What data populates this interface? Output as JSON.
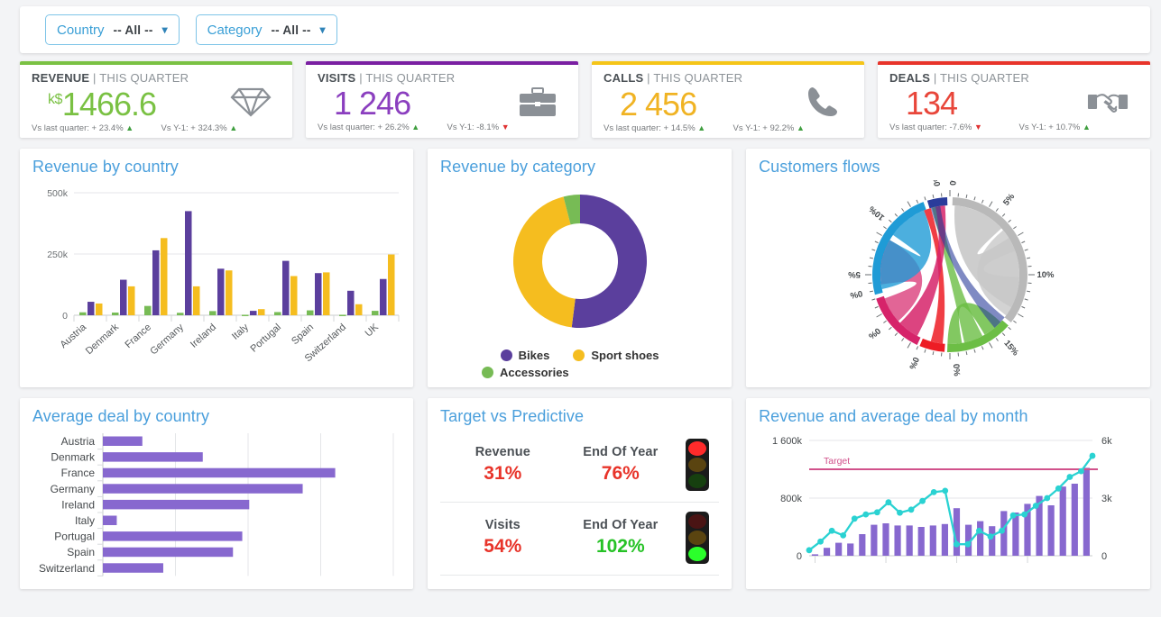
{
  "filters": [
    {
      "label": "Country",
      "value": "-- All --",
      "icon": "chevron-down-icon"
    },
    {
      "label": "Category",
      "value": "-- All --",
      "icon": "chevron-down-icon"
    }
  ],
  "kpis": [
    {
      "name": "REVENUE",
      "period": "THIS QUARTER",
      "prefix": "k$",
      "value": "1466.6",
      "color": "#7ac143",
      "bar": "#7ac143",
      "icon": "diamond-icon",
      "compare_quarter": "Vs last quarter: + 23.4%",
      "quarter_dir": "up",
      "compare_year": "Vs Y-1: + 324.3%",
      "year_dir": "up"
    },
    {
      "name": "VISITS",
      "period": "THIS QUARTER",
      "prefix": "",
      "value": "1 246",
      "color": "#8b3fbf",
      "bar": "#7a1fa2",
      "icon": "briefcase-icon",
      "compare_quarter": "Vs last quarter: + 26.2%",
      "quarter_dir": "up",
      "compare_year": "Vs Y-1: -8.1%",
      "year_dir": "down"
    },
    {
      "name": "CALLS",
      "period": "THIS QUARTER",
      "prefix": "",
      "value": "2 456",
      "color": "#f0b323",
      "bar": "#f5c518",
      "icon": "phone-icon",
      "compare_quarter": "Vs last quarter: + 14.5%",
      "quarter_dir": "up",
      "compare_year": "Vs Y-1: + 92.2%",
      "year_dir": "up"
    },
    {
      "name": "DEALS",
      "period": "THIS QUARTER",
      "prefix": "",
      "value": "134",
      "color": "#e8463a",
      "bar": "#e8342a",
      "icon": "handshake-icon",
      "compare_quarter": "Vs last quarter: -7.6%",
      "quarter_dir": "down",
      "compare_year": "Vs Y-1: + 10.7%",
      "year_dir": "up"
    }
  ],
  "panels": {
    "revenue_by_country": "Revenue by country",
    "revenue_by_category": "Revenue by category",
    "customers_flows": "Customers flows",
    "average_deal": "Average deal by country",
    "target_vs_predictive": "Target vs Predictive",
    "revenue_avg_deal": "Revenue and average deal by month"
  },
  "category_legend": [
    {
      "label": "Bikes",
      "color": "#5b3f9d"
    },
    {
      "label": "Sport shoes",
      "color": "#f5bd1f"
    },
    {
      "label": "Accessories",
      "color": "#77bb55"
    }
  ],
  "target_vs_predictive": {
    "rows": [
      {
        "metric": "Revenue",
        "metric_value": "31%",
        "metric_color": "#e8342a",
        "eoy_label": "End Of Year",
        "eoy_value": "76%",
        "eoy_color": "#e8342a",
        "light": "red"
      },
      {
        "metric": "Visits",
        "metric_value": "54%",
        "metric_color": "#e8342a",
        "eoy_label": "End Of Year",
        "eoy_value": "102%",
        "eoy_color": "#26c226",
        "light": "green"
      }
    ]
  },
  "chart_data": [
    {
      "type": "bar",
      "title": "Revenue by country",
      "xlabel": "",
      "ylabel": "",
      "ylim": [
        0,
        500000
      ],
      "yticks": [
        0,
        250000,
        500000
      ],
      "ytick_labels": [
        "0",
        "250k",
        "500k"
      ],
      "grid": true,
      "legend_position": "none",
      "categories": [
        "Austria",
        "Denmark",
        "France",
        "Germany",
        "Ireland",
        "Italy",
        "Portugal",
        "Spain",
        "Switzerland",
        "UK"
      ],
      "series": [
        {
          "name": "Accessories",
          "color": "#77bb55",
          "values": [
            12000,
            11000,
            38000,
            10000,
            17000,
            2000,
            13000,
            20000,
            2000,
            18000
          ]
        },
        {
          "name": "Bikes",
          "color": "#5b3f9d",
          "values": [
            55000,
            145000,
            265000,
            425000,
            190000,
            18000,
            222000,
            172000,
            100000,
            148000
          ]
        },
        {
          "name": "Sport shoes",
          "color": "#f5bd1f",
          "values": [
            48000,
            118000,
            315000,
            118000,
            183000,
            25000,
            160000,
            175000,
            45000,
            248000
          ]
        }
      ]
    },
    {
      "type": "pie",
      "title": "Revenue by category",
      "donut": true,
      "legend_position": "bottom",
      "labels": [
        "Bikes",
        "Sport shoes",
        "Accessories"
      ],
      "values": [
        52,
        44,
        4
      ],
      "colors": [
        "#5b3f9d",
        "#f5bd1f",
        "#77bb55"
      ]
    },
    {
      "type": "chord",
      "title": "Customers flows",
      "tick_labels": [
        "0%",
        "5%",
        "10%",
        "15%",
        "0%",
        "0%",
        "0%",
        "0%",
        "5%",
        "10%",
        "0%"
      ],
      "groups": [
        {
          "name": "group-gray",
          "color": "#b9b9b9",
          "start_deg": 2,
          "end_deg": 128,
          "share": 35
        },
        {
          "name": "group-green",
          "color": "#6cbe45",
          "start_deg": 131,
          "end_deg": 182,
          "share": 14
        },
        {
          "name": "group-red",
          "color": "#ed1c24",
          "start_deg": 184,
          "end_deg": 203,
          "share": 5
        },
        {
          "name": "group-magenta",
          "color": "#d6236a",
          "start_deg": 205,
          "end_deg": 252,
          "share": 13
        },
        {
          "name": "group-blue",
          "color": "#1f9bd6",
          "start_deg": 255,
          "end_deg": 340,
          "share": 24
        },
        {
          "name": "group-navy",
          "color": "#2a3c9b",
          "start_deg": 343,
          "end_deg": 358,
          "share": 9
        }
      ]
    },
    {
      "type": "bar",
      "orientation": "horizontal",
      "title": "Average deal by country",
      "grid": true,
      "legend_position": "none",
      "color": "#8768cf",
      "categories": [
        "Austria",
        "Denmark",
        "France",
        "Germany",
        "Ireland",
        "Italy",
        "Portugal",
        "Spain",
        "Switzerland"
      ],
      "values": [
        17,
        43,
        100,
        86,
        63,
        6,
        60,
        56,
        26
      ],
      "xlim": [
        0,
        125
      ]
    },
    {
      "type": "line",
      "title": "Revenue and average deal by month",
      "grid": true,
      "legend_position": "none",
      "ylim": [
        0,
        1600000
      ],
      "yticks": [
        0,
        800000,
        1600000
      ],
      "ytick_labels": [
        "0",
        "800k",
        "1 600k"
      ],
      "y2lim": [
        0,
        6000
      ],
      "y2ticks": [
        0,
        3000,
        6000
      ],
      "y2tick_labels": [
        "0",
        "3k",
        "6k"
      ],
      "target_label": "Target",
      "target_value": 1200000,
      "target_color": "#d1518b",
      "bar_color": "#8768cf",
      "line_color": "#2ad2d2",
      "bars": [
        20000,
        110000,
        180000,
        170000,
        300000,
        430000,
        450000,
        420000,
        420000,
        400000,
        420000,
        440000,
        660000,
        430000,
        480000,
        410000,
        620000,
        600000,
        720000,
        830000,
        700000,
        960000,
        1000000,
        1220000
      ],
      "line": [
        290,
        740,
        1300,
        1060,
        1930,
        2150,
        2260,
        2780,
        2240,
        2400,
        2850,
        3310,
        3380,
        600,
        600,
        1300,
        1000,
        1300,
        2100,
        2150,
        2600,
        3000,
        3500,
        4100,
        4400,
        5200
      ]
    }
  ]
}
